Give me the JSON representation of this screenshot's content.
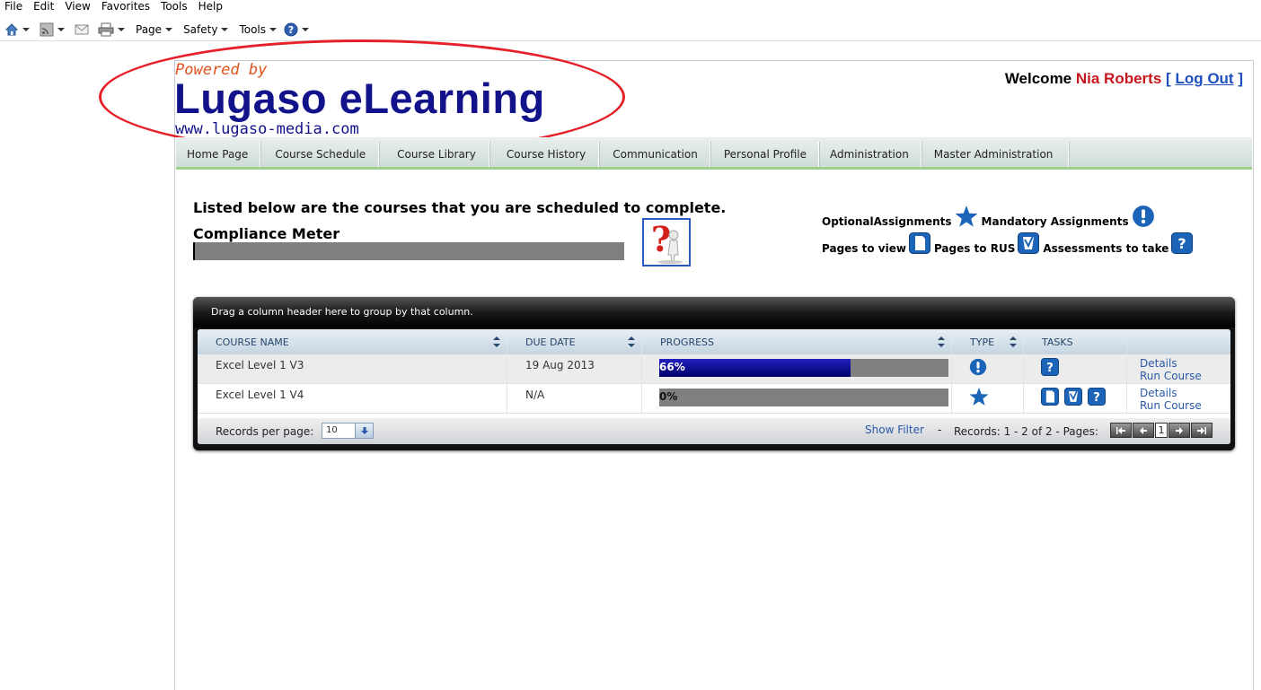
{
  "browser": {
    "menu": [
      "File",
      "Edit",
      "View",
      "Favorites",
      "Tools",
      "Help"
    ],
    "command": {
      "page": "Page",
      "safety": "Safety",
      "tools": "Tools"
    }
  },
  "logo": {
    "powered": "Powered by",
    "brand": "Lugaso eLearning",
    "url": "www.lugaso-media.com"
  },
  "user": {
    "welcome": "Welcome",
    "name": "Nia Roberts",
    "open_bracket": "[",
    "logout": "Log Out",
    "close_bracket": "]"
  },
  "nav": [
    "Home Page",
    "Course Schedule",
    "Course Library",
    "Course History",
    "Communication",
    "Personal Profile",
    "Administration",
    "Master Administration"
  ],
  "intro": {
    "title": "Listed below are the courses that you are scheduled to complete.",
    "meter_label": "Compliance Meter",
    "meter_progress": 0
  },
  "legend": {
    "optional": "OptionalAssignments",
    "mandatory": "Mandatory Assignments",
    "pages_view": "Pages to view",
    "pages_rus": "Pages to RUS",
    "assessments": "Assessments to take"
  },
  "grid": {
    "group_hint": "Drag a column header here to group by that column.",
    "columns": [
      "COURSE NAME",
      "DUE DATE",
      "PROGRESS",
      "TYPE",
      "TASKS"
    ],
    "rows": [
      {
        "course": "Excel Level 1 V3",
        "due": "19 Aug 2013",
        "progress": 66,
        "progress_label": "66%",
        "type": "mandatory",
        "tasks": [
          "assessment"
        ],
        "details": "Details",
        "run": "Run Course"
      },
      {
        "course": "Excel Level 1 V4",
        "due": "N/A",
        "progress": 0,
        "progress_label": "0%",
        "type": "optional",
        "tasks": [
          "page-view",
          "page-rus",
          "assessment"
        ],
        "details": "Details",
        "run": "Run Course"
      }
    ],
    "footer": {
      "records_per_page_label": "Records per page:",
      "records_per_page": "10",
      "show_filter": "Show Filter",
      "dash": "-",
      "records": "Records: 1 - 2 of 2 - Pages:",
      "current_page": "1"
    }
  },
  "colors": {
    "brand_blue": "#12128a",
    "powered_orange": "#e0531f",
    "user_red": "#c8161d",
    "link_blue": "#1f4fbf",
    "annotation_red": "#e5202a",
    "icon_blue": "#1c64b8"
  }
}
